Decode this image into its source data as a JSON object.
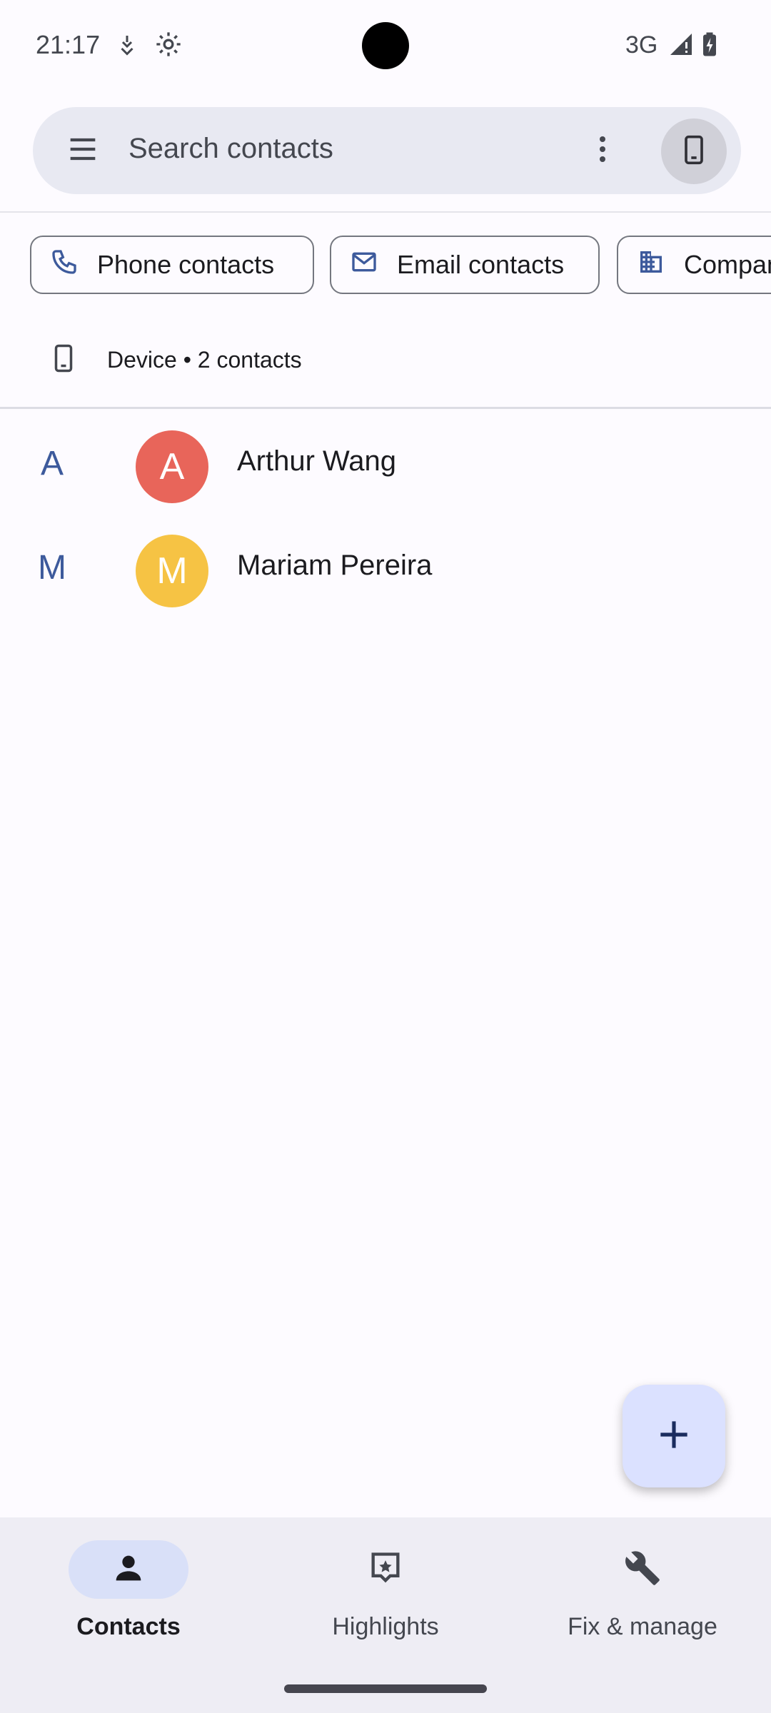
{
  "status_bar": {
    "time": "21:17",
    "network": "3G",
    "icons": [
      "data-saver-icon",
      "settings-gear-icon",
      "signal-icon",
      "battery-charging-icon"
    ]
  },
  "search": {
    "placeholder": "Search contacts",
    "menu_icon": "menu-icon",
    "more_icon": "more-vert-icon",
    "account_icon": "phone-icon"
  },
  "filters": {
    "chips": [
      {
        "label": "Phone contacts",
        "icon": "phone-icon"
      },
      {
        "label": "Email contacts",
        "icon": "mail-icon"
      },
      {
        "label": "Company",
        "icon": "business-icon"
      }
    ]
  },
  "account_section": {
    "label": "Device • 2 contacts",
    "icon": "smartphone-icon"
  },
  "contacts": [
    {
      "index_letter": "A",
      "initial": "A",
      "name": "Arthur Wang",
      "color": "#e8655a"
    },
    {
      "index_letter": "M",
      "initial": "M",
      "name": "Mariam Pereira",
      "color": "#f6c344"
    }
  ],
  "fab": {
    "icon": "add-icon"
  },
  "bottom_nav": {
    "items": [
      {
        "label": "Contacts",
        "icon": "contacts-icon",
        "active": true
      },
      {
        "label": "Highlights",
        "icon": "highlights-icon",
        "active": false
      },
      {
        "label": "Fix & manage",
        "icon": "wrench-icon",
        "active": false
      }
    ]
  },
  "colors": {
    "accent": "#3d5a9c",
    "surface": "#fdfbff",
    "search_bg": "#e8e9f2",
    "fab_bg": "#dbe1ff",
    "nav_active_pill": "#d9e0f8"
  }
}
